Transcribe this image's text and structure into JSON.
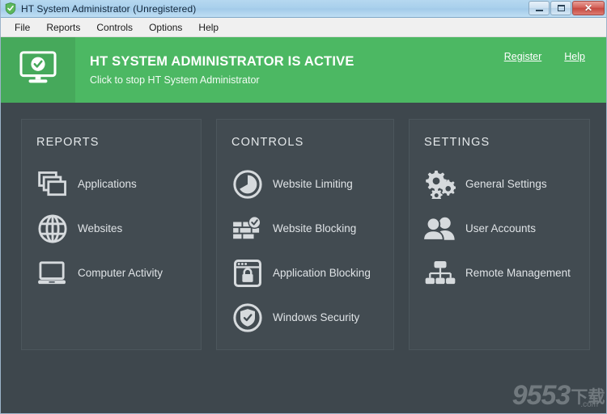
{
  "window": {
    "title": "HT System Administrator  (Unregistered)",
    "shield_icon": "shield-check-icon",
    "minimize_label": "Minimize",
    "maximize_label": "Maximize",
    "close_label": "✕"
  },
  "menubar": {
    "items": [
      {
        "label": "File",
        "name": "menu-file"
      },
      {
        "label": "Reports",
        "name": "menu-reports"
      },
      {
        "label": "Controls",
        "name": "menu-controls"
      },
      {
        "label": "Options",
        "name": "menu-options"
      },
      {
        "label": "Help",
        "name": "menu-help"
      }
    ]
  },
  "banner": {
    "icon": "monitor-check-icon",
    "title": "HT SYSTEM ADMINISTRATOR IS ACTIVE",
    "subtitle": "Click to stop HT System Administrator",
    "links": [
      {
        "label": "Register",
        "name": "register-link"
      },
      {
        "label": "Help",
        "name": "help-link"
      }
    ],
    "color": "#4cb863",
    "icon_box_color": "#46a95b"
  },
  "panels": [
    {
      "title": "REPORTS",
      "name": "panel-reports",
      "items": [
        {
          "label": "Applications",
          "icon": "stacked-windows-icon",
          "name": "item-applications"
        },
        {
          "label": "Websites",
          "icon": "globe-icon",
          "name": "item-websites"
        },
        {
          "label": "Computer Activity",
          "icon": "laptop-icon",
          "name": "item-computer-activity"
        }
      ]
    },
    {
      "title": "CONTROLS",
      "name": "panel-controls",
      "items": [
        {
          "label": "Website Limiting",
          "icon": "clock-icon",
          "name": "item-website-limiting"
        },
        {
          "label": "Website Blocking",
          "icon": "firewall-check-icon",
          "name": "item-website-blocking"
        },
        {
          "label": "Application Blocking",
          "icon": "window-lock-icon",
          "name": "item-application-blocking"
        },
        {
          "label": "Windows Security",
          "icon": "shield-check-circle-icon",
          "name": "item-windows-security"
        }
      ]
    },
    {
      "title": "SETTINGS",
      "name": "panel-settings",
      "items": [
        {
          "label": "General Settings",
          "icon": "gears-icon",
          "name": "item-general-settings"
        },
        {
          "label": "User Accounts",
          "icon": "users-icon",
          "name": "item-user-accounts"
        },
        {
          "label": "Remote Management",
          "icon": "network-tree-icon",
          "name": "item-remote-management"
        }
      ]
    }
  ],
  "watermark": {
    "number": "9553",
    "cn": "下载",
    "domain": ".com"
  },
  "colors": {
    "background": "#3e474d",
    "panel": "#424b51",
    "accent_green": "#4cb863",
    "text": "#dfe3e6"
  }
}
